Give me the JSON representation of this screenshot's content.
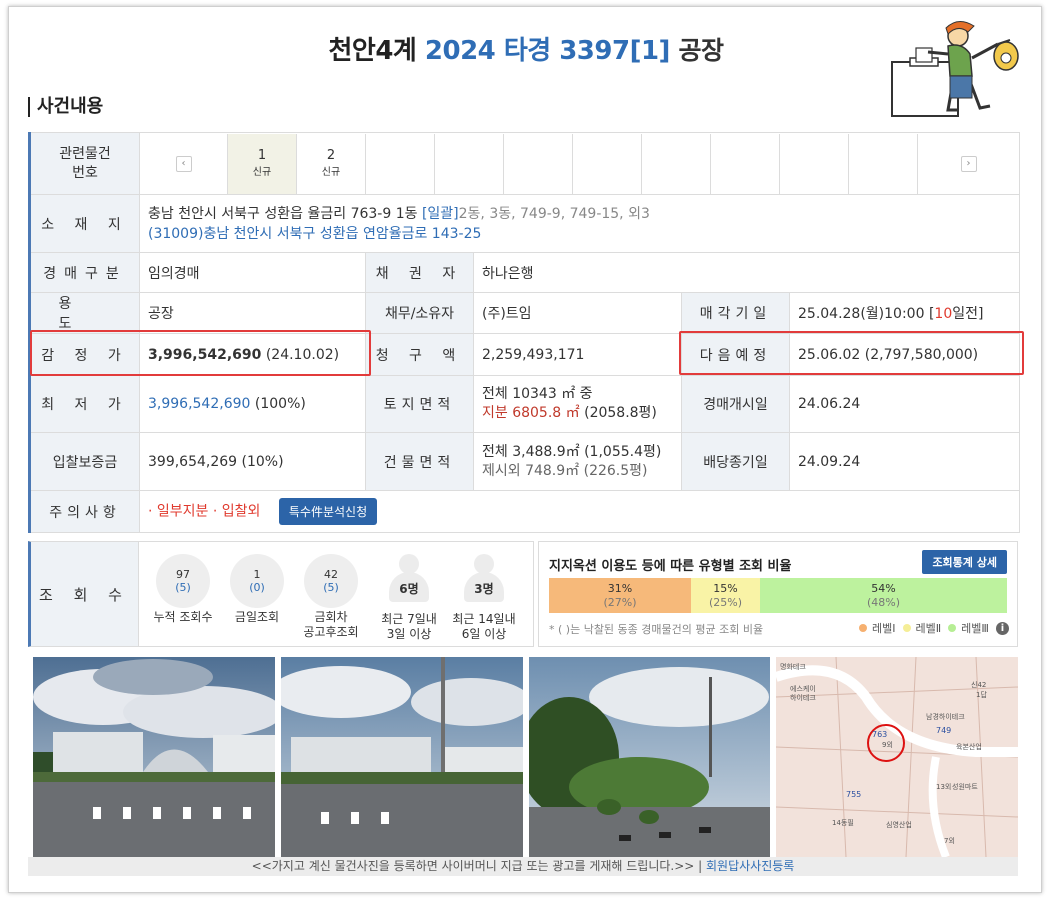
{
  "header": {
    "court": "천안4계",
    "case_no": "2024 타경 3397[1]",
    "type": "공장"
  },
  "section": {
    "title": "사건내용"
  },
  "related": {
    "label": "관련물건\n번호",
    "items": [
      {
        "num": "1",
        "tag": "신규",
        "selected": true
      },
      {
        "num": "2",
        "tag": "신규",
        "selected": false
      }
    ],
    "prev_icon": "‹",
    "next_icon": "›"
  },
  "location": {
    "label": "소 재 지",
    "line1_addr": "충남 천안시 서북구 성환읍 율금리 763-9 1동",
    "line1_bulk": "[일괄]",
    "line1_rest": "2동, 3동, 749-9, 749-15, 외3",
    "line2": "(31009)충남 천안시 서북구  성환읍 연암율금로  143-25"
  },
  "rows": {
    "auction_type_label": "경매구분",
    "auction_type": "임의경매",
    "creditor_label": "채 권 자",
    "creditor": "하나은행",
    "usage_label": "용 도",
    "usage": "공장",
    "debtor_label": "채무/소유자",
    "debtor": "(주)트임",
    "sale_date_label": "매각기일",
    "sale_date": "25.04.28(월)10:00 [",
    "sale_days": "10",
    "sale_days_suffix": "일전]",
    "appraisal_label": "감 정 가",
    "appraisal": "3,996,542,690",
    "appraisal_date": " (24.10.02)",
    "claim_label": "청 구 액",
    "claim": "2,259,493,171",
    "next_label": "다음예정",
    "next": "25.06.02 (2,797,580,000)",
    "min_label": "최 저 가",
    "min_price": "3,996,542,690",
    "min_pct": " (100%)",
    "land_label": "토지면적",
    "land_line1": "전체 10343 ㎡ 중",
    "land_share": "지분 6805.8 ㎡",
    "land_share_py": " (2058.8평)",
    "start_label": "경매개시일",
    "start": "24.06.24",
    "deposit_label": "입찰보증금",
    "deposit": "399,654,269 (10%)",
    "bldg_label": "건물면적",
    "bldg_line1": "전체 3,488.9㎡ (1,055.4평)",
    "bldg_line2": "제시외 748.9㎡ (226.5평)",
    "dividend_label": "배당종기일",
    "dividend": "24.09.24",
    "caution_label": "주의사항",
    "caution": "· 일부지분 · 입찰외",
    "caution_btn": "특수件분석신청"
  },
  "views": {
    "label": "조 회 수",
    "stats": [
      {
        "value": "97",
        "sub": "(5)",
        "cap1": "누적 조회수",
        "cap2": ""
      },
      {
        "value": "1",
        "sub": "(0)",
        "cap1": "금일조회",
        "cap2": ""
      },
      {
        "value": "42",
        "sub": "(5)",
        "cap1": "금회차",
        "cap2": "공고후조회"
      }
    ],
    "people": [
      {
        "value": "6명",
        "cap1": "최근 7일내",
        "cap2": "3일 이상"
      },
      {
        "value": "3명",
        "cap1": "최근 14일내",
        "cap2": "6일 이상"
      }
    ]
  },
  "ratio": {
    "title": "지지옥션 이용도 등에 따른 유형별 조회 비율",
    "button": "조회통계 상세",
    "segments": [
      {
        "pct": "31%",
        "avg": "(27%)",
        "color": "#f6b97a",
        "share": 0.31
      },
      {
        "pct": "15%",
        "avg": "(25%)",
        "color": "#f9f3a6",
        "share": 0.15
      },
      {
        "pct": "54%",
        "avg": "(48%)",
        "color": "#bdf29e",
        "share": 0.54
      }
    ],
    "note": "* ( )는 낙찰된 동종 경매물건의 평균 조회 비율",
    "legend": [
      {
        "label": "레벨Ⅰ",
        "color": "#f6b070"
      },
      {
        "label": "레벨Ⅱ",
        "color": "#f5ee97"
      },
      {
        "label": "레벨Ⅲ",
        "color": "#b6ee94"
      }
    ],
    "info_icon": "i"
  },
  "map": {
    "labels": [
      "명화테크",
      "에스케이",
      "하이테크",
      "763",
      "9외",
      "749",
      "남경하이테크",
      "신42",
      "1답",
      "755",
      "14동필",
      "심영산업",
      "육본산업",
      "13외",
      "성원마트",
      "7외"
    ]
  },
  "footer": {
    "text": "<<가지고 계신 물건사진을 등록하면 사이버머니 지급 또는 광고를 게재해 드립니다.>>",
    "sep": " | ",
    "link": "회원답사사진등록"
  }
}
